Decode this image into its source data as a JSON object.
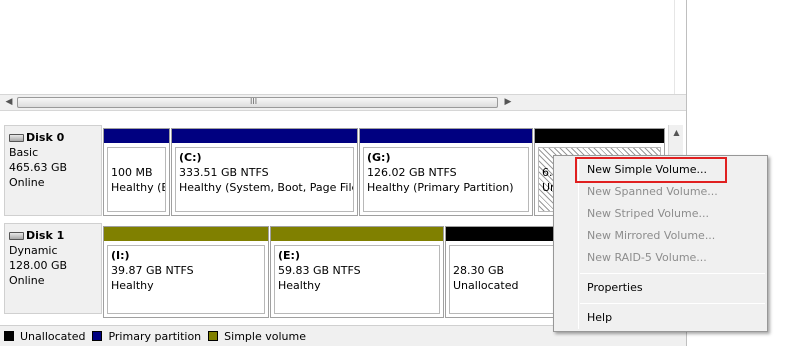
{
  "scrollbar": {
    "grip": "III"
  },
  "disks": [
    {
      "name": "Disk 0",
      "type": "Basic",
      "size": "465.63 GB",
      "status": "Online"
    },
    {
      "name": "Disk 1",
      "type": "Dynamic",
      "size": "128.00 GB",
      "status": "Online"
    }
  ],
  "disk0_partitions": [
    {
      "letter": "",
      "size": "100 MB",
      "status": "Healthy (E"
    },
    {
      "letter": "(C:)",
      "size": "333.51 GB NTFS",
      "status": "Healthy (System, Boot, Page File,"
    },
    {
      "letter": "(G:)",
      "size": "126.02 GB NTFS",
      "status": "Healthy (Primary Partition)"
    },
    {
      "letter": "",
      "size": "6.0",
      "status": "Ur"
    }
  ],
  "disk1_partitions": [
    {
      "letter": "(I:)",
      "size": "39.87 GB NTFS",
      "status": "Healthy"
    },
    {
      "letter": "(E:)",
      "size": "59.83 GB NTFS",
      "status": "Healthy"
    },
    {
      "letter": "",
      "size": "28.30 GB",
      "status": "Unallocated"
    }
  ],
  "legend": [
    {
      "label": "Unallocated",
      "color": "#000000"
    },
    {
      "label": "Primary partition",
      "color": "#000080"
    },
    {
      "label": "Simple volume",
      "color": "#808000"
    }
  ],
  "context_menu": {
    "items": [
      {
        "label": "New Simple Volume...",
        "enabled": true
      },
      {
        "label": "New Spanned Volume...",
        "enabled": false
      },
      {
        "label": "New Striped Volume...",
        "enabled": false
      },
      {
        "label": "New Mirrored Volume...",
        "enabled": false
      },
      {
        "label": "New RAID-5 Volume...",
        "enabled": false
      },
      {
        "label": "Properties",
        "enabled": true
      },
      {
        "label": "Help",
        "enabled": true
      }
    ],
    "highlight_color": "#e02020"
  }
}
